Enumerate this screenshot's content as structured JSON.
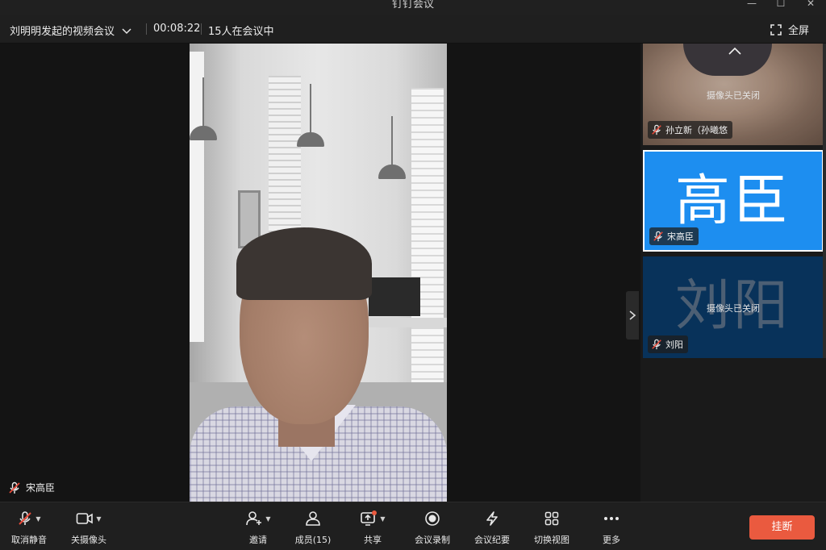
{
  "window": {
    "title": "钉钉会议"
  },
  "infobar": {
    "meeting_title": "刘明明发起的视频会议",
    "timer": "00:08:22",
    "participants_in_meeting": "15人在会议中",
    "fullscreen_label": "全屏"
  },
  "stage": {
    "speaker_name": "宋高臣"
  },
  "panel": {
    "tiles": [
      {
        "name": "孙立新（孙曦悠",
        "status": "摄像头已关闭",
        "avatar_text": ""
      },
      {
        "name": "宋高臣",
        "status": "",
        "avatar_text": "高臣"
      },
      {
        "name": "刘阳",
        "status": "摄像头已关闭",
        "avatar_text": "刘阳"
      }
    ]
  },
  "toolbar": {
    "unmute": "取消静音",
    "camera_off": "关摄像头",
    "invite": "邀请",
    "members": "成员(15)",
    "share": "共享",
    "record": "会议录制",
    "minutes": "会议纪要",
    "switch_view": "切换视图",
    "more": "更多",
    "hangup": "挂断"
  },
  "colors": {
    "accent_blue": "#1d8ef0",
    "hangup_red": "#ea5a3f",
    "mute_red": "#e84a3a",
    "dark_tile": "#08325a"
  }
}
